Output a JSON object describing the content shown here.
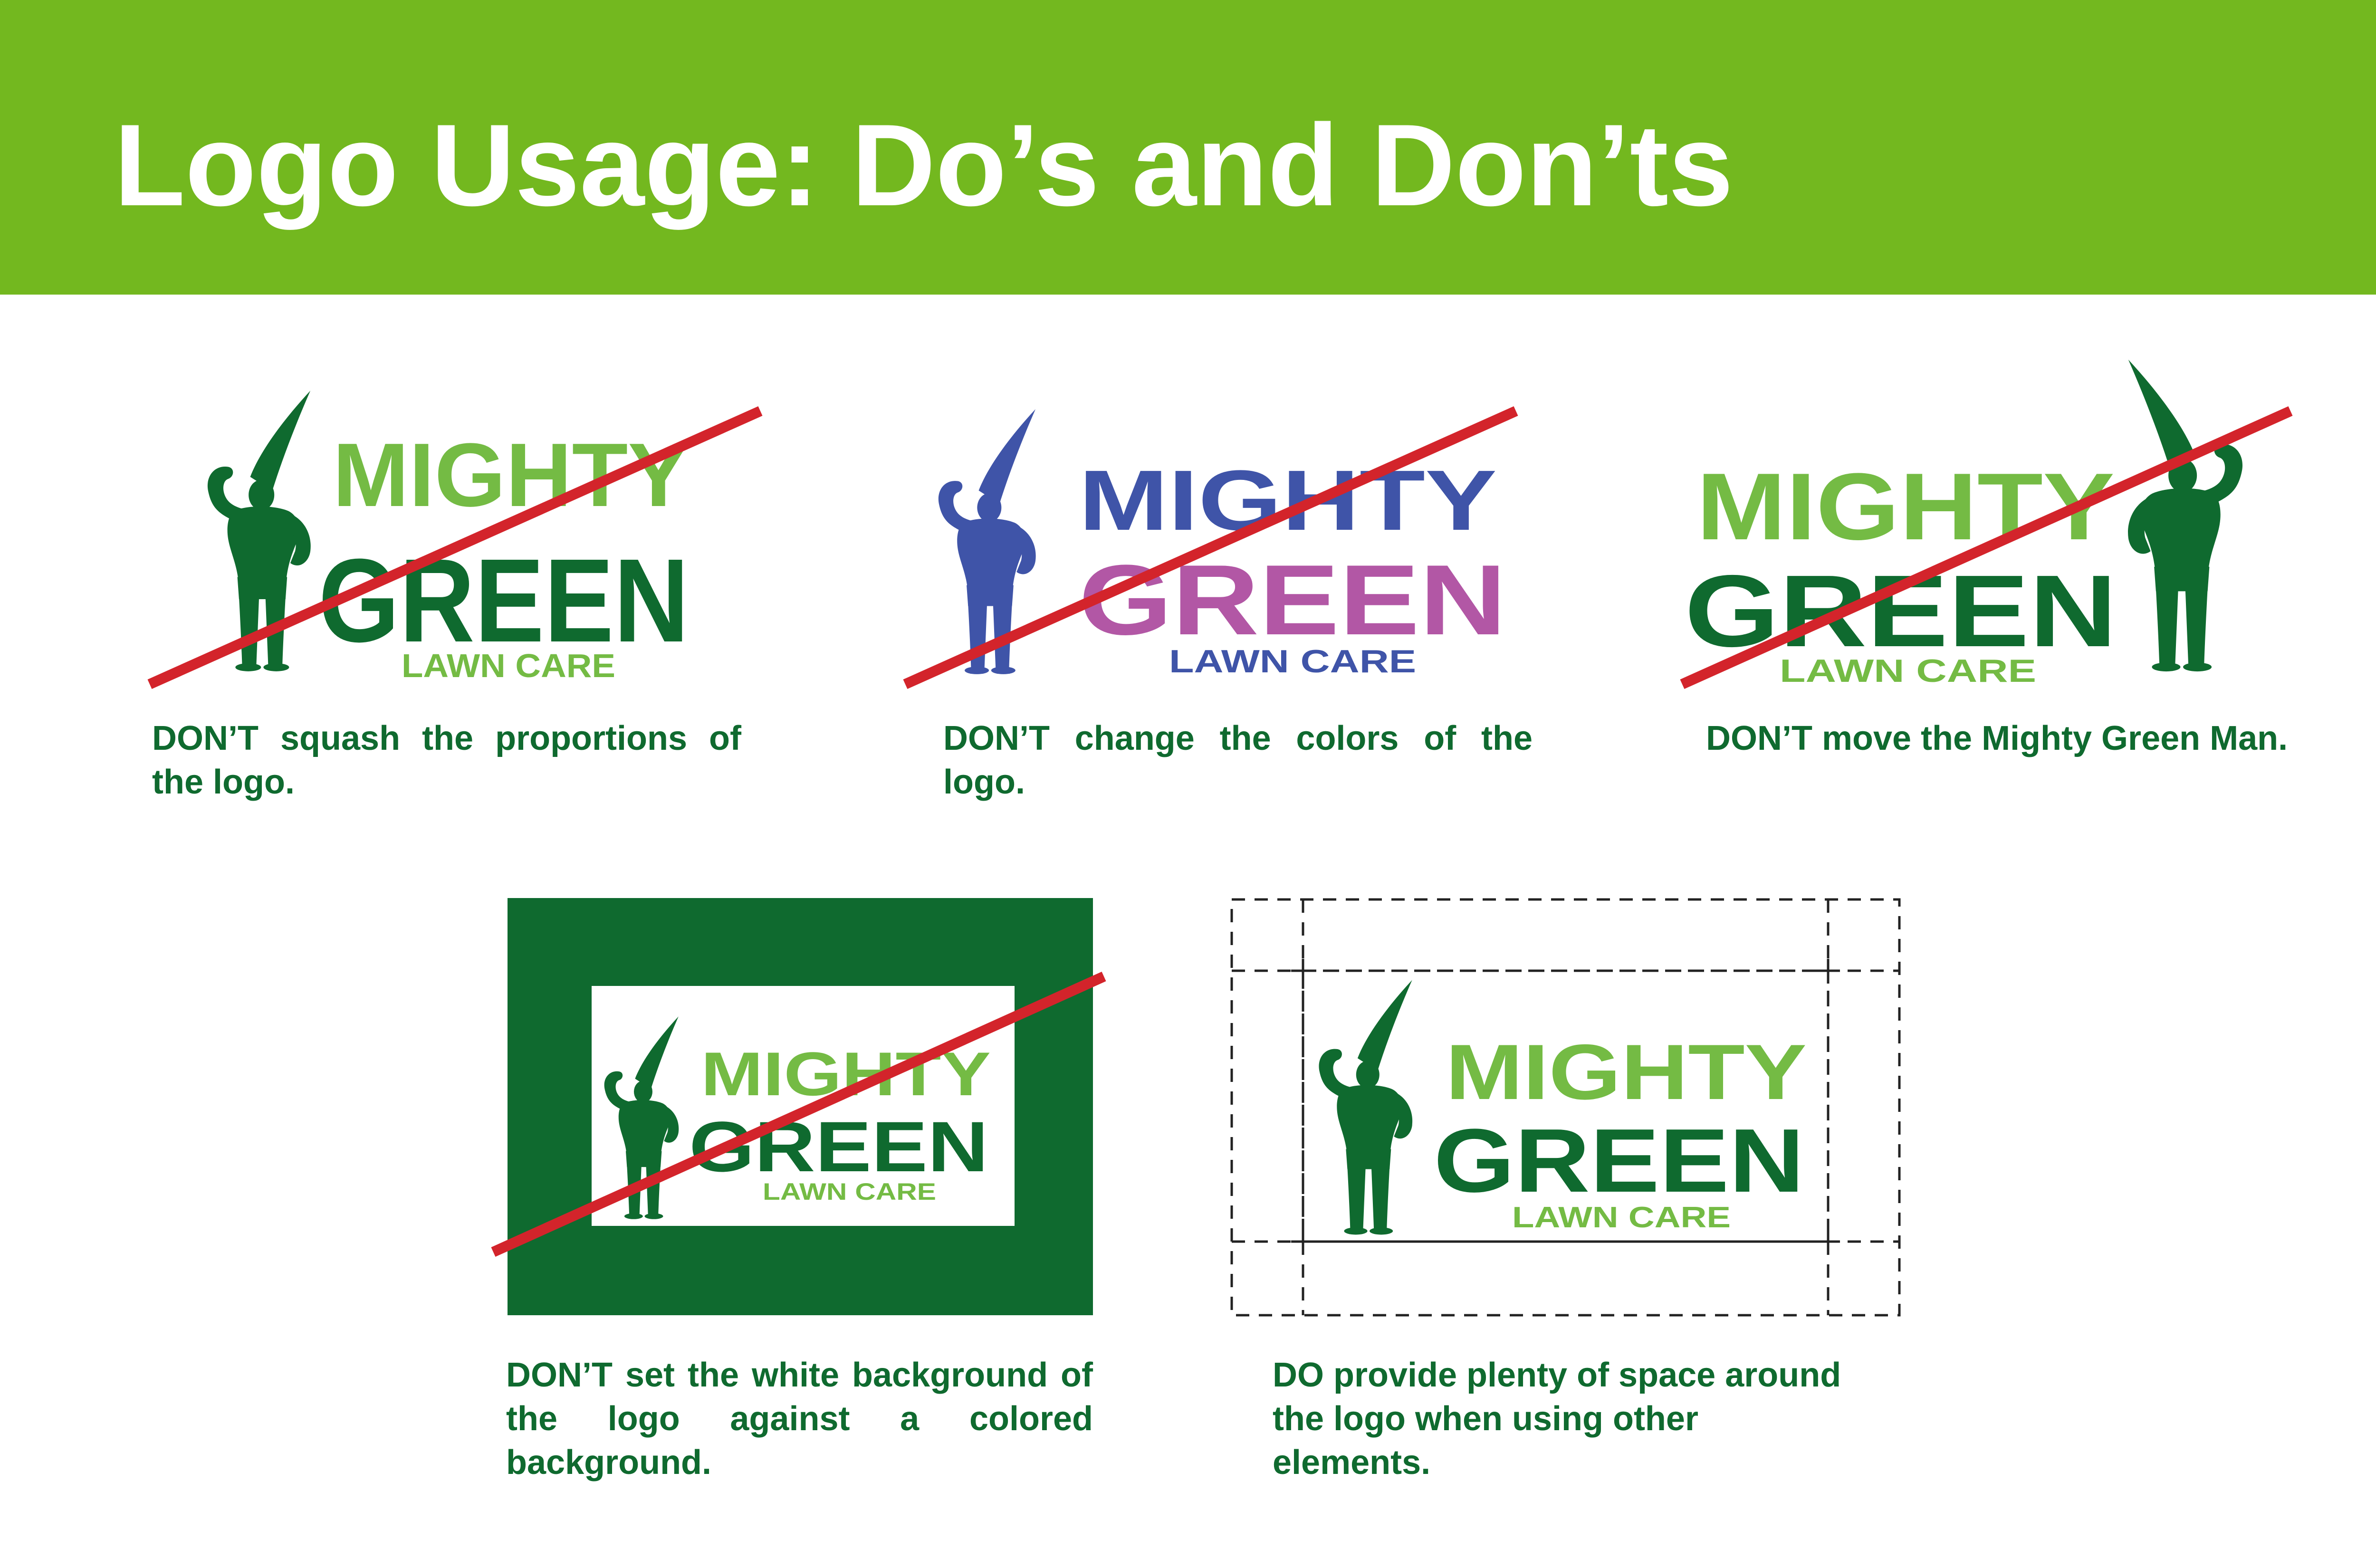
{
  "page": {
    "title": "Logo Usage: Do’s and Don’ts"
  },
  "logo_text": {
    "word1": "MIGHTY",
    "word2": "GREEN",
    "word3": "LAWN CARE"
  },
  "examples": [
    {
      "caption": "DON’T squash the proportions of the logo.",
      "crossed_out": true
    },
    {
      "caption": "DON’T change the colors of the logo.",
      "crossed_out": true
    },
    {
      "caption": "DON’T move the Mighty Green Man.",
      "crossed_out": true
    },
    {
      "caption": "DON’T set the white background of the logo against a colored background.",
      "crossed_out": true
    },
    {
      "caption": "DO provide plenty of space around the logo when using other elements.",
      "crossed_out": false
    }
  ],
  "colors": {
    "header_green": "#73b81f",
    "logo_light_green": "#74bb44",
    "logo_dark_green": "#0f6a2f",
    "wrong_blue": "#3f54a8",
    "wrong_magenta": "#b257a5",
    "slash_red": "#d3242b"
  },
  "icons": [
    "mighty-green-man-mascot-icon",
    "grass-blade-icon"
  ]
}
